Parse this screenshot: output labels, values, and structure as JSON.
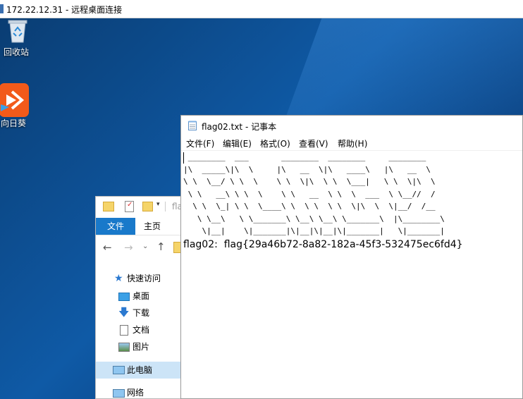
{
  "rdp": {
    "title": "172.22.12.31 - 远程桌面连接"
  },
  "desktop": {
    "icons": [
      {
        "label": "回收站",
        "icon": "recycle-bin-icon"
      },
      {
        "label": "向日葵",
        "icon": "sunflower-app-icon"
      }
    ]
  },
  "explorer": {
    "addr_fragment": "fla",
    "tabs": {
      "file": "文件",
      "home": "主页"
    },
    "nav": [
      {
        "label": "快速访问",
        "icon": "star-icon"
      },
      {
        "label": "桌面",
        "icon": "desktop-icon"
      },
      {
        "label": "下载",
        "icon": "download-icon"
      },
      {
        "label": "文档",
        "icon": "document-icon"
      },
      {
        "label": "图片",
        "icon": "picture-icon"
      },
      {
        "label": "此电脑",
        "icon": "computer-icon"
      },
      {
        "label": "网络",
        "icon": "network-icon"
      }
    ]
  },
  "notepad": {
    "title": "flag02.txt - 记事本",
    "menu": [
      "文件(F)",
      "编辑(E)",
      "格式(O)",
      "查看(V)",
      "帮助(H)"
    ],
    "ascii_art": " ________  ___       ________  ________     ________     \n|\\  _____\\|\\  \\     |\\   __  \\|\\   ____\\   |\\   __  \\   \n\\ \\  \\__/ \\ \\  \\    \\ \\  \\|\\  \\ \\  \\___|   \\ \\  \\|\\  \\  \n \\ \\   __\\ \\ \\  \\    \\ \\   __  \\ \\  \\  ___  \\ \\__//  /  \n  \\ \\  \\_| \\ \\  \\____\\ \\  \\ \\  \\ \\  \\|\\  \\  \\|__/  /__ \n   \\ \\__\\   \\ \\_______\\ \\__\\ \\__\\ \\_______\\  |\\________\\\n    \\|__|    \\|_______|\\|__|\\|__|\\|_______|   \\|_______|",
    "flag_line": "flag02:  flag{29a46b72-8a82-182a-45f3-532475ec6fd4}"
  }
}
